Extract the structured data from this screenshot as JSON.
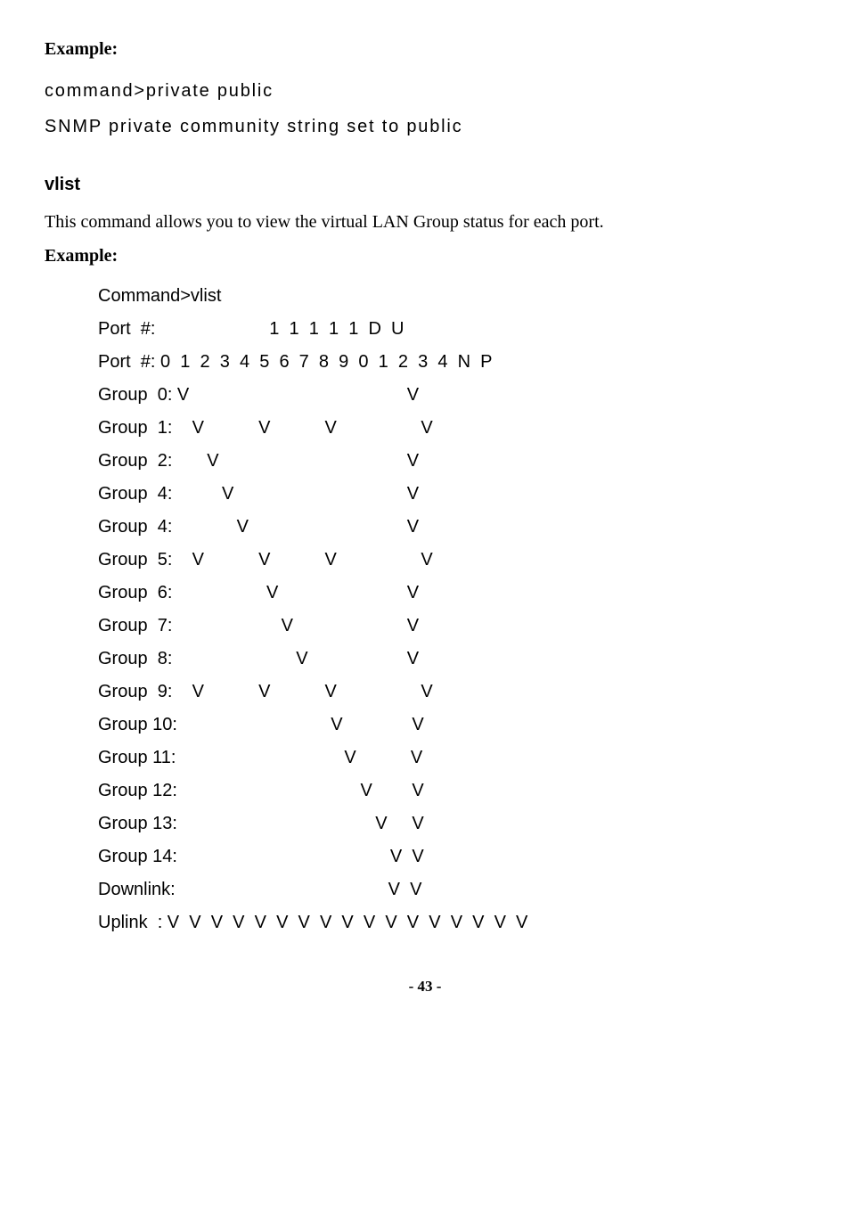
{
  "header1": "Example:",
  "term1_line1": "command>private public",
  "term1_line2": "SNMP private community string set to public",
  "section_title": "vlist",
  "section_desc": "This command allows you to view the virtual LAN Group status for each port.",
  "header2": "Example:",
  "chart_data": {
    "type": "table",
    "title": "vlist output — VLAN group port membership",
    "columns": [
      "0",
      "1",
      "2",
      "3",
      "4",
      "5",
      "6",
      "7",
      "8",
      "9",
      "10",
      "11",
      "12",
      "13",
      "14",
      "DN",
      "UP"
    ],
    "rows": {
      "Group 0": [
        "V",
        "",
        "",
        "",
        "",
        "",
        "",
        "",
        "",
        "",
        "",
        "",
        "",
        "",
        "",
        "",
        "V"
      ],
      "Group 1": [
        "",
        "V",
        "",
        "",
        "",
        "V",
        "",
        "",
        "",
        "V",
        "",
        "",
        "",
        "",
        "",
        "",
        "V"
      ],
      "Group 2": [
        "",
        "",
        "V",
        "",
        "",
        "",
        "",
        "",
        "",
        "",
        "",
        "",
        "",
        "",
        "",
        "",
        "V"
      ],
      "Group 4": [
        "",
        "",
        "",
        "V",
        "",
        "",
        "",
        "",
        "",
        "",
        "",
        "",
        "",
        "",
        "",
        "",
        "V"
      ],
      "Group 4 ": [
        "",
        "",
        "",
        "",
        "V",
        "",
        "",
        "",
        "",
        "",
        "",
        "",
        "",
        "",
        "",
        "",
        "V"
      ],
      "Group 5": [
        "",
        "V",
        "",
        "",
        "",
        "V",
        "",
        "",
        "",
        "V",
        "",
        "",
        "",
        "",
        "",
        "",
        "V"
      ],
      "Group 6": [
        "",
        "",
        "",
        "",
        "",
        "",
        "V",
        "",
        "",
        "",
        "",
        "",
        "",
        "",
        "",
        "",
        "V"
      ],
      "Group 7": [
        "",
        "",
        "",
        "",
        "",
        "",
        "",
        "V",
        "",
        "",
        "",
        "",
        "",
        "",
        "",
        "",
        "V"
      ],
      "Group 8": [
        "",
        "",
        "",
        "",
        "",
        "",
        "",
        "",
        "V",
        "",
        "",
        "",
        "",
        "",
        "",
        "",
        "V"
      ],
      "Group 9": [
        "",
        "V",
        "",
        "",
        "",
        "V",
        "",
        "",
        "",
        "V",
        "",
        "",
        "",
        "",
        "",
        "",
        "V"
      ],
      "Group 10": [
        "",
        "",
        "",
        "",
        "",
        "",
        "",
        "",
        "",
        "",
        "V",
        "",
        "",
        "",
        "",
        "",
        "V"
      ],
      "Group 11": [
        "",
        "",
        "",
        "",
        "",
        "",
        "",
        "",
        "",
        "",
        "",
        "V",
        "",
        "",
        "",
        "",
        "V"
      ],
      "Group 12": [
        "",
        "",
        "",
        "",
        "",
        "",
        "",
        "",
        "",
        "",
        "",
        "",
        "V",
        "",
        "",
        "",
        "V"
      ],
      "Group 13": [
        "",
        "",
        "",
        "",
        "",
        "",
        "",
        "",
        "",
        "",
        "",
        "",
        "",
        "V",
        "",
        "",
        "V"
      ],
      "Group 14": [
        "",
        "",
        "",
        "",
        "",
        "",
        "",
        "",
        "",
        "",
        "",
        "",
        "",
        "",
        "V",
        "",
        "V"
      ],
      "Downlink": [
        "",
        "",
        "",
        "",
        "",
        "",
        "",
        "",
        "",
        "",
        "",
        "",
        "",
        "",
        "",
        "V",
        "V"
      ],
      "Uplink": [
        "V",
        "V",
        "V",
        "V",
        "V",
        "V",
        "V",
        "V",
        "V",
        "V",
        "V",
        "V",
        "V",
        "V",
        "V",
        "V",
        "V"
      ]
    }
  },
  "term2": {
    "l0": "Command>vlist",
    "l1": "Port  #:                       1  1  1  1  1  D  U",
    "l2": "Port  #: 0  1  2  3  4  5  6  7  8  9  0  1  2  3  4  N  P",
    "l3": "Group  0: V                                            V",
    "l4": "Group  1:    V           V           V                 V",
    "l5": "Group  2:       V                                      V",
    "l6": "Group  4:          V                                   V",
    "l7": "Group  4:             V                                V",
    "l8": "Group  5:    V           V           V                 V",
    "l9": "Group  6:                   V                          V",
    "l10": "Group  7:                      V                       V",
    "l11": "Group  8:                         V                    V",
    "l12": "Group  9:    V           V           V                 V",
    "l13": "Group 10:                               V              V",
    "l14": "Group 11:                                  V           V",
    "l15": "Group 12:                                     V        V",
    "l16": "Group 13:                                        V     V",
    "l17": "Group 14:                                           V  V",
    "l18": "Downlink:                                           V  V",
    "l19": "Uplink  : V  V  V  V  V  V  V  V  V  V  V  V  V  V  V  V  V"
  },
  "page_number": "- 43 -"
}
